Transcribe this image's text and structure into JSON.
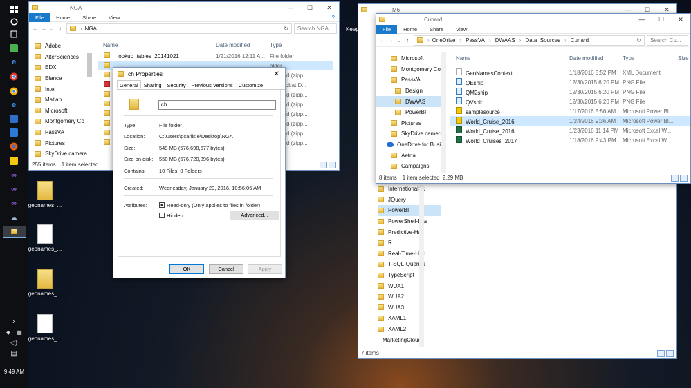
{
  "taskbar": {
    "clock": "9:49 AM",
    "icons": [
      "windows-start-icon",
      "cortana-icon",
      "task-view-icon",
      "store-icon",
      "edge-icon",
      "chrome-icon",
      "chrome-icon",
      "edge-icon",
      "onenote-icon",
      "vscode-icon",
      "firefox-icon",
      "powerbi-icon",
      "visualstudio-icon",
      "visualstudio-icon",
      "visualstudio-icon",
      "onedrive-icon",
      "file-explorer-icon"
    ],
    "tray": [
      "chevron-icon",
      "dropbox-icon",
      "network-icon",
      "volume-icon",
      "action-center-icon"
    ]
  },
  "desktop": {
    "icons": [
      {
        "label": "geonames_..."
      },
      {
        "label": "geonames_..."
      },
      {
        "label": "geonames_..."
      },
      {
        "label": "geonames_..."
      }
    ],
    "partial_label": "Keep"
  },
  "nga_window": {
    "title": "NGA",
    "ribbon": [
      "File",
      "Home",
      "Share",
      "View"
    ],
    "address": "NGA",
    "search_placeholder": "Search NGA",
    "nav_items": [
      "Adobe",
      "AlterSciences",
      "EDX",
      "Elance",
      "Intel",
      "Matlab",
      "Microsoft",
      "Montgomery Co",
      "PassVA",
      "Pictures",
      "SkyDrive camera"
    ],
    "columns": [
      "Name",
      "Date modified",
      "Type"
    ],
    "rows": [
      {
        "name": "_lookup_tables_20141021",
        "date": "1/21/2016 12:11 A...",
        "type": "File folder"
      },
      {
        "name": "",
        "date": "",
        "type": "older"
      },
      {
        "name": "",
        "date": "",
        "type": "pressed (zipp..."
      },
      {
        "name": "",
        "date": "",
        "type": "be Acrobat D..."
      },
      {
        "name": "",
        "date": "",
        "type": "pressed (zipp..."
      },
      {
        "name": "",
        "date": "",
        "type": "pressed (zipp..."
      },
      {
        "name": "",
        "date": "",
        "type": "pressed (zipp..."
      },
      {
        "name": "",
        "date": "",
        "type": "pressed (zipp..."
      },
      {
        "name": "",
        "date": "",
        "type": "pressed (zipp..."
      },
      {
        "name": "",
        "date": "",
        "type": "pressed (zipp..."
      }
    ],
    "status_items": "255 items",
    "status_selected": "1 item selected"
  },
  "m6_window": {
    "title": "M6",
    "partial_nav": [
      "InternationalSc",
      "JQuery",
      "PowerBI",
      "PowerShell-Bas",
      "Predictive-Had",
      "R",
      "Real-Time-Hac",
      "T-SQL-Queries",
      "TypeScript",
      "WUA1",
      "WUA2",
      "WUA3",
      "XAML1",
      "XAML2",
      "MarketingCloud"
    ],
    "status_items": "7 items"
  },
  "cunard_window": {
    "title": "Cunard",
    "ribbon": [
      "File",
      "Home",
      "Share",
      "View"
    ],
    "breadcrumb": [
      "OneDrive",
      "PassVA",
      "DWAAS",
      "Data_Sources",
      "Cunard"
    ],
    "search_placeholder": "Search Cu...",
    "nav_items": [
      {
        "label": "Microsoft",
        "indent": 1
      },
      {
        "label": "Montgomery Co",
        "indent": 1
      },
      {
        "label": "PassVA",
        "indent": 1
      },
      {
        "label": "Design",
        "indent": 2
      },
      {
        "label": "DWAAS",
        "indent": 2,
        "selected": true
      },
      {
        "label": "PowerBI",
        "indent": 2
      },
      {
        "label": "Pictures",
        "indent": 1
      },
      {
        "label": "SkyDrive camera",
        "indent": 1
      },
      {
        "label": "OneDrive for Busin",
        "indent": 0,
        "cloud": true
      },
      {
        "label": "Aetna",
        "indent": 1
      },
      {
        "label": "Campaigns",
        "indent": 1
      }
    ],
    "columns": [
      "Name",
      "Date modified",
      "Type",
      "Size"
    ],
    "rows": [
      {
        "name": "GeoNamesContext",
        "date": "1/18/2016 5:52 PM",
        "type": "XML Document",
        "icon": "xml"
      },
      {
        "name": "QEship",
        "date": "12/30/2015 6:20 PM",
        "type": "PNG File",
        "icon": "png"
      },
      {
        "name": "QM2ship",
        "date": "12/30/2015 6:20 PM",
        "type": "PNG File",
        "icon": "png"
      },
      {
        "name": "QVship",
        "date": "12/30/2015 6:20 PM",
        "type": "PNG File",
        "icon": "png"
      },
      {
        "name": "samplesource",
        "date": "1/17/2016 5:56 AM",
        "type": "Microsoft Power Bl...",
        "icon": "pbi"
      },
      {
        "name": "World_Cruise_2016",
        "date": "1/24/2016 9:36 AM",
        "type": "Microsoft Power Bl...",
        "icon": "pbi",
        "selected": true
      },
      {
        "name": "World_Cruise_2016",
        "date": "1/23/2016 11:14 PM",
        "type": "Microsoft Excel W...",
        "icon": "xls"
      },
      {
        "name": "World_Cruises_2017",
        "date": "1/18/2016 9:43 PM",
        "type": "Microsoft Excel W...",
        "icon": "xls"
      }
    ],
    "status_items": "8 items",
    "status_selected": "1 item selected",
    "status_size": "2.29 MB"
  },
  "properties_dialog": {
    "title": "ch Properties",
    "tabs": [
      "General",
      "Sharing",
      "Security",
      "Previous Versions",
      "Customize"
    ],
    "name": "ch",
    "type_label": "Type:",
    "type_value": "File folder",
    "location_label": "Location:",
    "location_value": "C:\\Users\\gcarlisle\\Desktop\\NGA",
    "size_label": "Size:",
    "size_value": "549 MB (576,698,577 bytes)",
    "size_on_disk_label": "Size on disk:",
    "size_on_disk_value": "550 MB (576,720,896 bytes)",
    "contains_label": "Contains:",
    "contains_value": "10 Files, 0 Folders",
    "created_label": "Created:",
    "created_value": "Wednesday, January 20, 2016, 10:56:06 AM",
    "attributes_label": "Attributes:",
    "readonly_label": "Read-only (Only applies to files in folder)",
    "hidden_label": "Hidden",
    "advanced_button": "Advanced...",
    "ok_button": "OK",
    "cancel_button": "Cancel",
    "apply_button": "Apply"
  },
  "colors": {
    "accent": "#1979ca",
    "selection": "#cde8ff",
    "taskbar": "#0d0f13"
  }
}
